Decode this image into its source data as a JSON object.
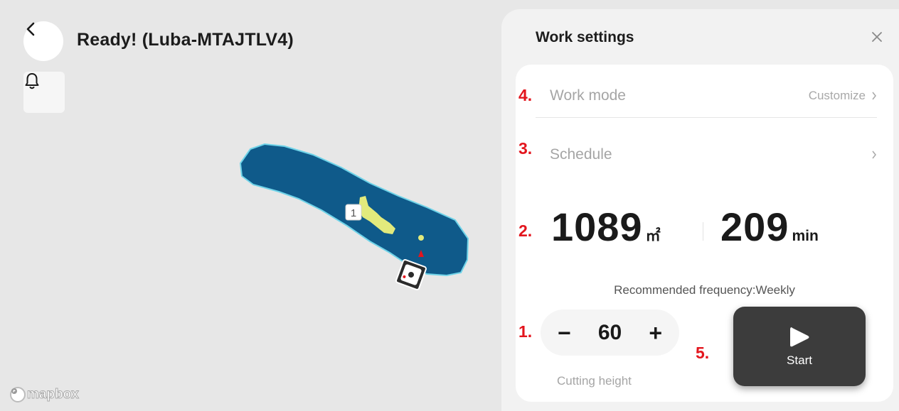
{
  "header": {
    "title": "Ready! (Luba-MTAJTLV4)",
    "back_icon": "chevron-left-icon",
    "bell_icon": "bell-icon"
  },
  "map": {
    "attribution": "mapbox",
    "zone_label": "1",
    "colors": {
      "background": "#e7e7e7",
      "lawn": "#0f5a8a",
      "lawn_edge": "#6fd3e8",
      "obstacle": "#e2ea7c"
    }
  },
  "panel": {
    "title": "Work settings",
    "close_icon": "close-icon",
    "work_mode": {
      "label": "Work mode",
      "value": "Customize"
    },
    "schedule": {
      "label": "Schedule",
      "value": ""
    },
    "area": {
      "value": "1089",
      "unit": "㎡"
    },
    "duration": {
      "value": "209",
      "unit": "min"
    },
    "frequency": "Recommended frequency:Weekly",
    "cutting_height": {
      "value": "60",
      "minus": "−",
      "plus": "+",
      "label": "Cutting height"
    },
    "start": {
      "label": "Start",
      "icon": "play-icon"
    }
  },
  "markers": {
    "m1": "1.",
    "m2": "2.",
    "m3": "3.",
    "m4": "4.",
    "m5": "5."
  },
  "accent": {
    "marker_red": "#e3151d",
    "start_bg": "#3c3c3c"
  }
}
